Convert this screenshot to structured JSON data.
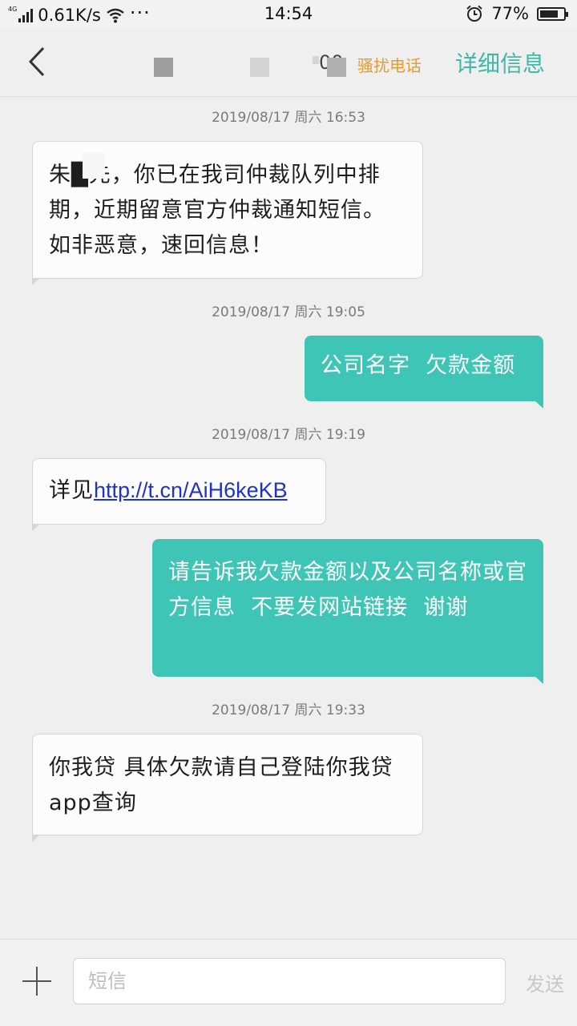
{
  "status_bar": {
    "network": "4G",
    "speed": "0.61K/s",
    "dots": "···",
    "time": "14:54",
    "battery_percent": "77%",
    "battery_level": 0.77
  },
  "header": {
    "contact_fragment": "00",
    "spam_label": "骚扰电话",
    "detail_label": "详细信息"
  },
  "messages": [
    {
      "timestamp": "2019/08/17  周六  16:53",
      "direction": "in",
      "text": "朱█先，你已在我司仲裁队列中排期，近期留意官方仲裁通知短信。如非恶意，速回信息！"
    },
    {
      "timestamp": "2019/08/17  周六  19:05",
      "direction": "out",
      "text": "公司名字  欠款金额"
    },
    {
      "timestamp": "2019/08/17  周六  19:19",
      "direction": "in",
      "text_prefix": "详见",
      "link": "http://t.cn/AiH6keKB"
    },
    {
      "direction": "out",
      "text": "请告诉我欠款金额以及公司名称或官方信息  不要发网站链接  谢谢"
    },
    {
      "timestamp": "2019/08/17  周六  19:33",
      "direction": "in",
      "text": "你我贷 具体欠款请自己登陆你我贷app查询"
    }
  ],
  "composer": {
    "placeholder": "短信",
    "send_label": "发送"
  }
}
